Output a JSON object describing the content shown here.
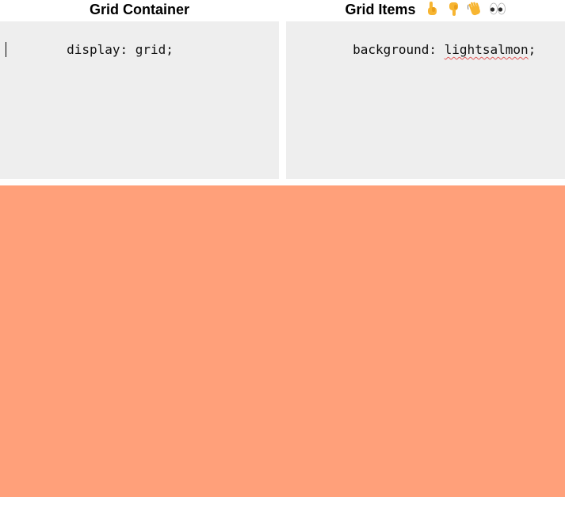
{
  "colors": {
    "editor_bg": "#eeeeee",
    "preview_bg": "#ffa07a",
    "page_bg": "#ffffff"
  },
  "container_panel": {
    "title": "Grid Container",
    "code": "display: grid;"
  },
  "items_panel": {
    "title": "Grid Items",
    "emojis": [
      "pointing-up-icon",
      "pointing-down-icon",
      "waving-hand-icon",
      "eyes-icon"
    ],
    "code_prop": "background: ",
    "code_value": "lightsalmon",
    "code_end": ";"
  }
}
